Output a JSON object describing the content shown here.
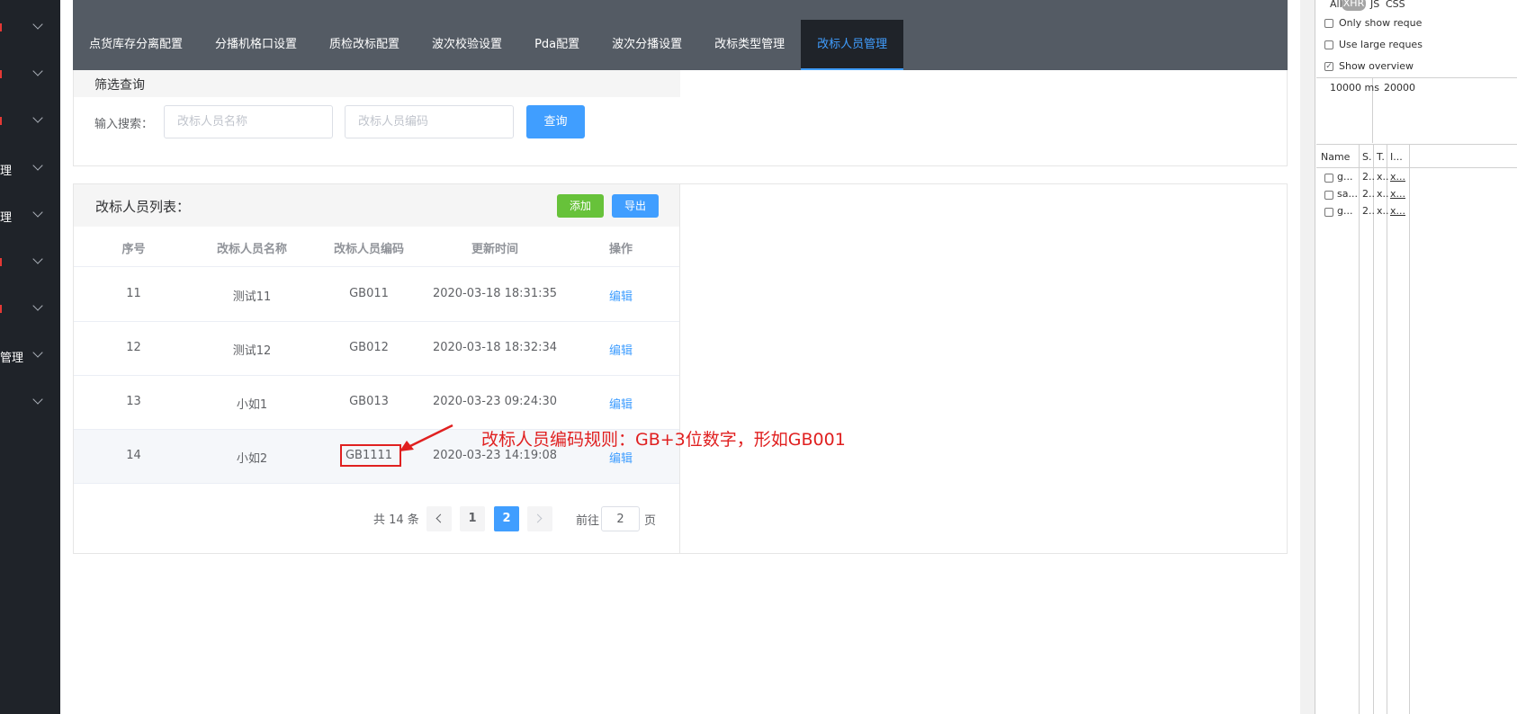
{
  "sidebar": {
    "items": [
      {
        "label": "",
        "red": true
      },
      {
        "label": "",
        "red": true
      },
      {
        "label": "",
        "red": true
      },
      {
        "label": "理",
        "red": false
      },
      {
        "label": "理",
        "red": false
      },
      {
        "label": "",
        "red": true
      },
      {
        "label": "",
        "red": true
      },
      {
        "label": "管理",
        "red": false
      },
      {
        "label": "",
        "red": false
      }
    ]
  },
  "tabs": [
    {
      "label": "点货库存分离配置"
    },
    {
      "label": "分播机格口设置"
    },
    {
      "label": "质检改标配置"
    },
    {
      "label": "波次校验设置"
    },
    {
      "label": "Pda配置"
    },
    {
      "label": "波次分播设置"
    },
    {
      "label": "改标类型管理"
    },
    {
      "label": "改标人员管理",
      "active": true
    }
  ],
  "filter": {
    "title": "筛选查询",
    "search_label": "输入搜索：",
    "name_placeholder": "改标人员名称",
    "code_placeholder": "改标人员编码",
    "query_label": "查询"
  },
  "list": {
    "title": "改标人员列表：",
    "add_label": "添加",
    "export_label": "导出",
    "columns": [
      "序号",
      "改标人员名称",
      "改标人员编码",
      "更新时间",
      "操作"
    ],
    "rows": [
      {
        "no": "11",
        "name": "测试11",
        "code": "GB011",
        "time": "2020-03-18 18:31:35",
        "action": "编辑"
      },
      {
        "no": "12",
        "name": "测试12",
        "code": "GB012",
        "time": "2020-03-18 18:32:34",
        "action": "编辑"
      },
      {
        "no": "13",
        "name": "小如1",
        "code": "GB013",
        "time": "2020-03-23 09:24:30",
        "action": "编辑"
      },
      {
        "no": "14",
        "name": "小如2",
        "code": "GB1111",
        "time": "2020-03-23 14:19:08",
        "action": "编辑"
      }
    ]
  },
  "pagination": {
    "total": "共 14 条",
    "pages": [
      "1",
      "2"
    ],
    "current": "2",
    "goto_label": "前往",
    "goto_value": "2",
    "page_unit": "页"
  },
  "annotation": {
    "text": "改标人员编码规则：GB+3位数字，形如GB001",
    "color": "#e02020"
  },
  "devtools": {
    "filter_types": [
      "All",
      "XHR",
      "JS",
      "CSS"
    ],
    "only_show": "Only show reque",
    "large_requests": "Use large reques",
    "show_overview": "Show overview",
    "timeline": [
      "10000 ms",
      "20000"
    ],
    "columns": [
      "Name",
      "S.",
      "T.",
      "I..."
    ],
    "requests": [
      {
        "name": "g...",
        "s": "2..",
        "t": "x..",
        "i": "x..."
      },
      {
        "name": "sa...",
        "s": "2..",
        "t": "x..",
        "i": "x..."
      },
      {
        "name": "g...",
        "s": "2..",
        "t": "x..",
        "i": "x..."
      }
    ]
  },
  "colors": {
    "accent": "#409eff",
    "add_button": "#67c23a",
    "sidebar": "#1f2329",
    "topbar": "#545b64"
  }
}
